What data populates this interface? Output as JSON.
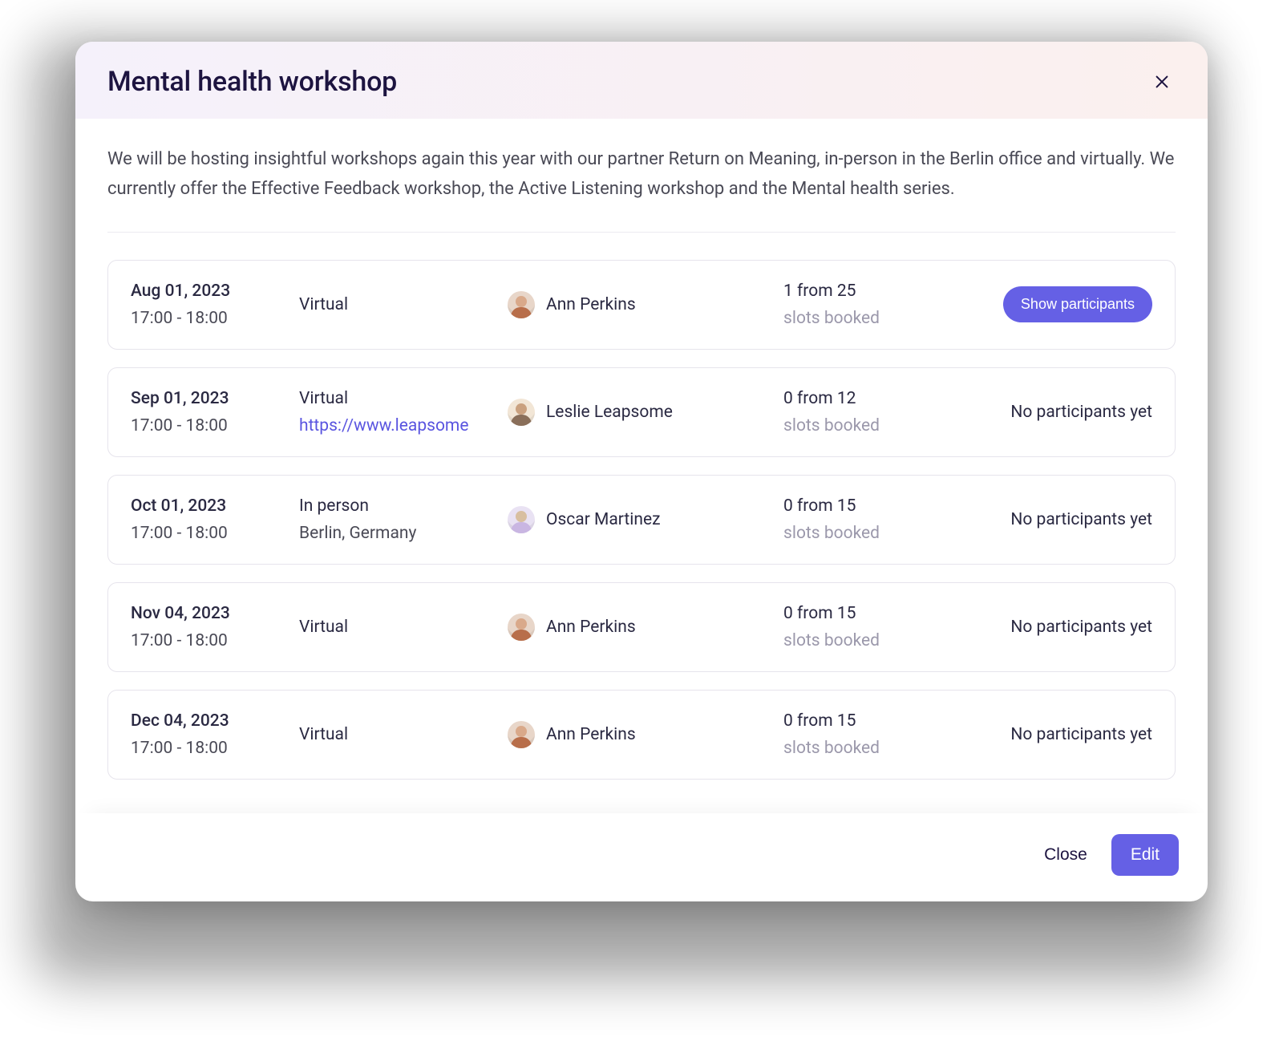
{
  "modal": {
    "title": "Mental health workshop",
    "intro": "We will be hosting insightful workshops again this year with our partner Return on Meaning, in-person in the Berlin office and virtually. We currently offer the Effective Feedback workshop, the Active Listening workshop and the Mental health series.",
    "slots_sub_label": "slots booked",
    "show_participants_label": "Show participants",
    "no_participants_label": "No participants yet",
    "footer": {
      "close": "Close",
      "edit": "Edit"
    }
  },
  "sessions": [
    {
      "date": "Aug 01, 2023",
      "time": "17:00 - 18:00",
      "mode": "Virtual",
      "sub": "",
      "host": "Ann Perkins",
      "avatar_variant": "v1",
      "slots": "1 from 25",
      "has_participants": true
    },
    {
      "date": "Sep 01, 2023",
      "time": "17:00 - 18:00",
      "mode": "Virtual",
      "sub": "https://www.leapsome",
      "sub_is_link": true,
      "host": "Leslie Leapsome",
      "avatar_variant": "v2",
      "slots": "0 from 12",
      "has_participants": false
    },
    {
      "date": "Oct 01, 2023",
      "time": "17:00 - 18:00",
      "mode": "In person",
      "sub": "Berlin, Germany",
      "host": "Oscar Martinez",
      "avatar_variant": "v3",
      "slots": "0 from 15",
      "has_participants": false
    },
    {
      "date": "Nov 04, 2023",
      "time": "17:00 - 18:00",
      "mode": "Virtual",
      "sub": "",
      "host": "Ann Perkins",
      "avatar_variant": "v1",
      "slots": "0 from 15",
      "has_participants": false
    },
    {
      "date": "Dec 04, 2023",
      "time": "17:00 - 18:00",
      "mode": "Virtual",
      "sub": "",
      "host": "Ann Perkins",
      "avatar_variant": "v1",
      "slots": "0 from 15",
      "has_participants": false
    }
  ]
}
